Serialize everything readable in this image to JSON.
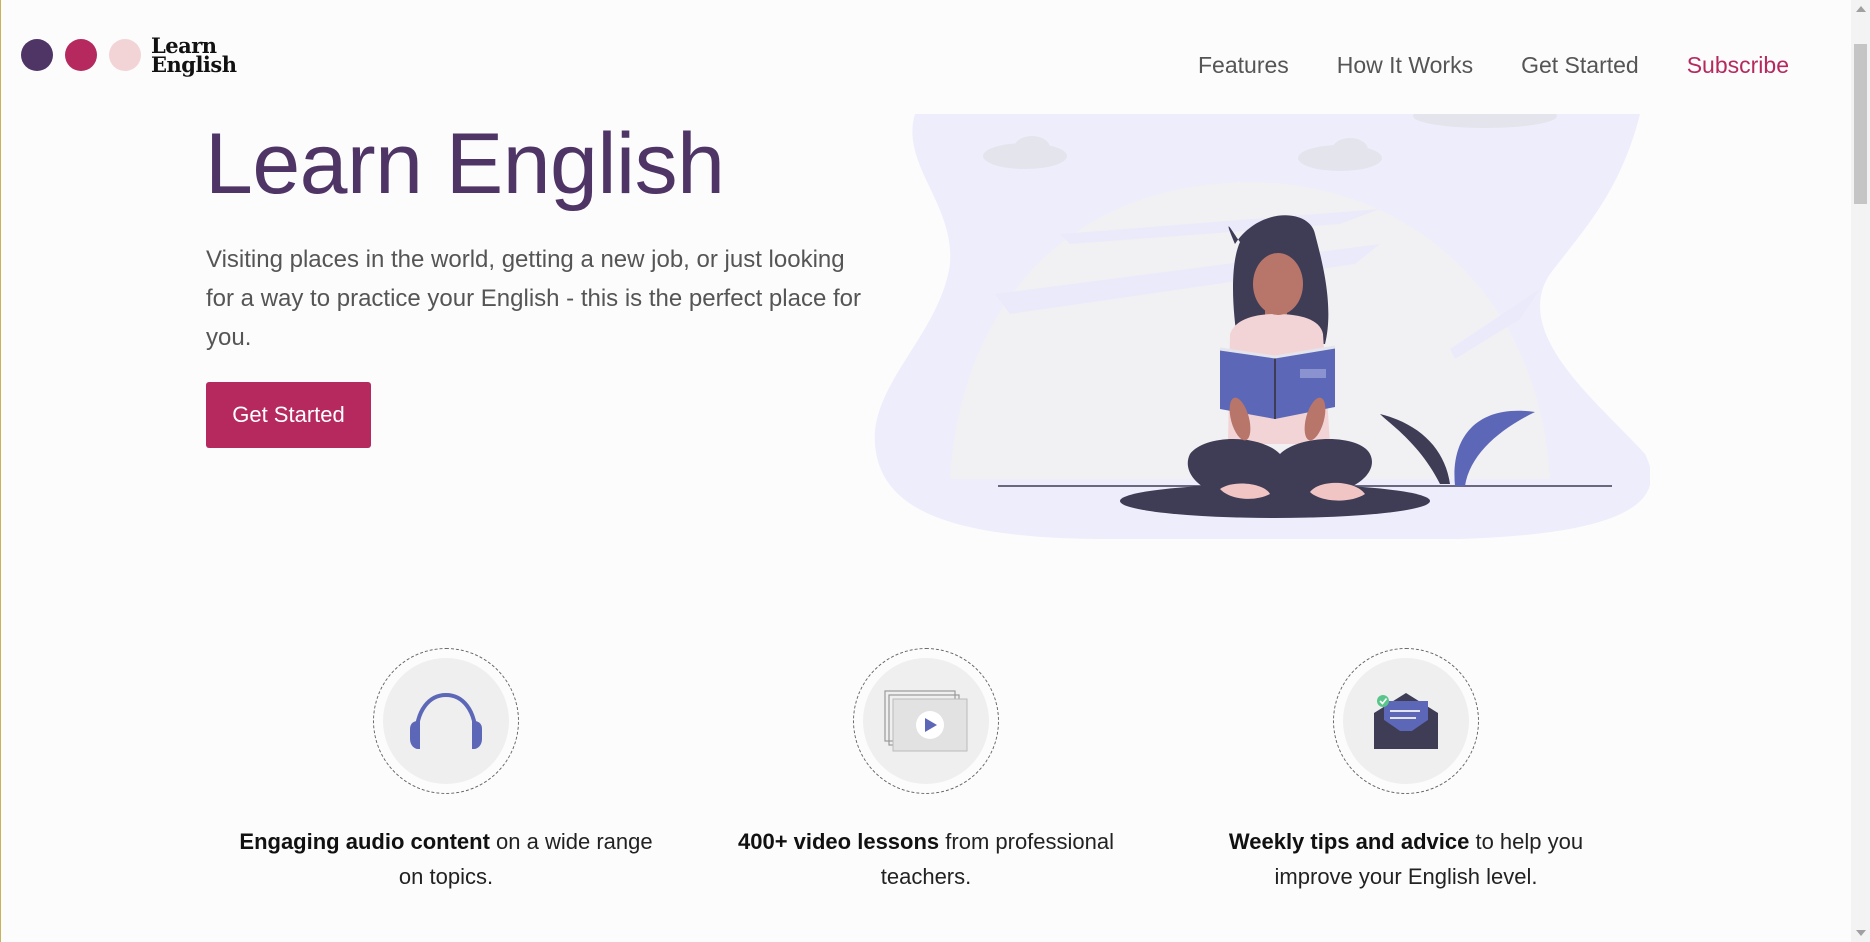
{
  "brand": {
    "line1": "Learn",
    "line2": "English",
    "dot_colors": [
      "#4f3466",
      "#b5295f",
      "#f2d4d6"
    ]
  },
  "nav": {
    "items": [
      {
        "label": "Features"
      },
      {
        "label": "How It Works"
      },
      {
        "label": "Get Started"
      },
      {
        "label": "Subscribe"
      }
    ]
  },
  "hero": {
    "title": "Learn English",
    "text": "Visiting places in the world, getting a new job, or just looking for a way to practice your English - this is the perfect place for you.",
    "cta_label": "Get Started",
    "illustration_icon": "woman-reading-book-illustration"
  },
  "features": [
    {
      "icon": "headphones-icon",
      "bold": "Engaging audio content",
      "rest": " on a wide range on topics."
    },
    {
      "icon": "video-play-icon",
      "bold": "400+ video lessons",
      "rest": " from professional teachers."
    },
    {
      "icon": "envelope-icon",
      "bold": "Weekly tips and advice",
      "rest": " to help you improve your English level."
    }
  ],
  "colors": {
    "primary": "#4f3466",
    "accent": "#b5295f",
    "illustration_bg": "#eeedfb",
    "icon_blue": "#5c67b8"
  }
}
